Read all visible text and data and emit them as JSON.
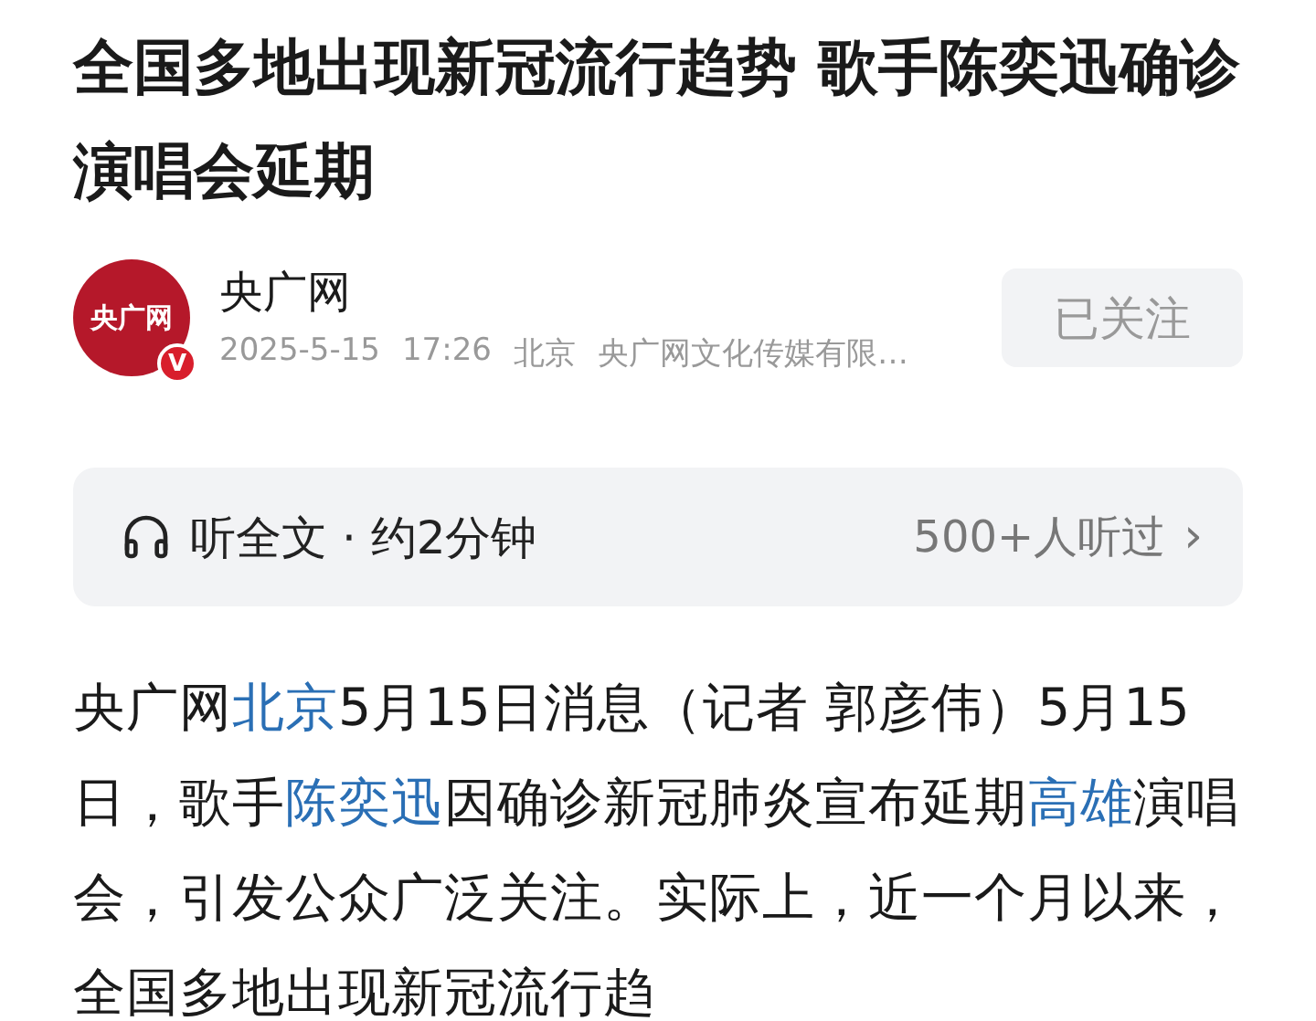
{
  "article": {
    "title": "全国多地出现新冠流行趋势 歌手陈奕迅确诊演唱会延期",
    "author": {
      "avatar_text": "央广网",
      "verified_badge": "V",
      "name": "央广网",
      "date": "2025-5-15",
      "time": "17:26",
      "location": "北京",
      "source": "央广网文化传媒有限…",
      "follow_button": "已关注"
    },
    "listen_bar": {
      "label": "听全文 · 约2分钟",
      "listeners": "500+人听过",
      "chevron": "›"
    },
    "body": [
      {
        "kind": "text",
        "text": "央广网"
      },
      {
        "kind": "link",
        "text": "北京"
      },
      {
        "kind": "text",
        "text": "5月15日消息（记者 郭彦伟）5月15日，歌手"
      },
      {
        "kind": "link",
        "text": "陈奕迅"
      },
      {
        "kind": "text",
        "text": "因确诊新冠肺炎宣布延期"
      },
      {
        "kind": "link",
        "text": "高雄"
      },
      {
        "kind": "text",
        "text": "演唱会，引发公众广泛关注。实际上，近一个月以来，全国多地出现新冠流行趋"
      }
    ]
  }
}
